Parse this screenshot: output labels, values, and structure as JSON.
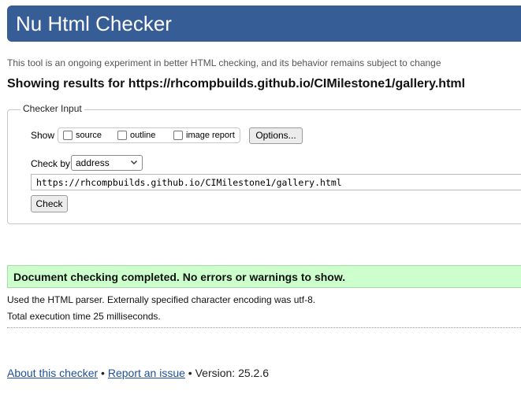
{
  "header": {
    "title": "Nu Html Checker"
  },
  "subtitle": "This tool is an ongoing experiment in better HTML checking, and its behavior remains subject to change",
  "results_heading": {
    "prefix": "Showing results for ",
    "url": "https://rhcompbuilds.github.io/CIMilestone1/gallery.html"
  },
  "checker_input": {
    "legend": "Checker Input",
    "show_label": "Show",
    "show_options": [
      {
        "label": "source",
        "checked": false
      },
      {
        "label": "outline",
        "checked": false
      },
      {
        "label": "image report",
        "checked": false
      }
    ],
    "options_button": "Options...",
    "check_by_label": "Check by",
    "check_by_value": "address",
    "url_value": "https://rhcompbuilds.github.io/CIMilestone1/gallery.html",
    "check_button": "Check"
  },
  "result": {
    "success_message": "Document checking completed. No errors or warnings to show.",
    "parser_info": "Used the HTML parser. Externally specified character encoding was utf-8.",
    "execution_time": "Total execution time 25 milliseconds."
  },
  "footer": {
    "about_link": "About this checker",
    "separator1": " • ",
    "report_link": "Report an issue",
    "separator2": " • ",
    "version": "Version: 25.2.6"
  },
  "colors": {
    "header_bg": "#365d95",
    "success_bg": "#ccffcc",
    "link": "#1f4f9a"
  },
  "icons": {
    "select_arrow": "chevron-down-icon"
  }
}
